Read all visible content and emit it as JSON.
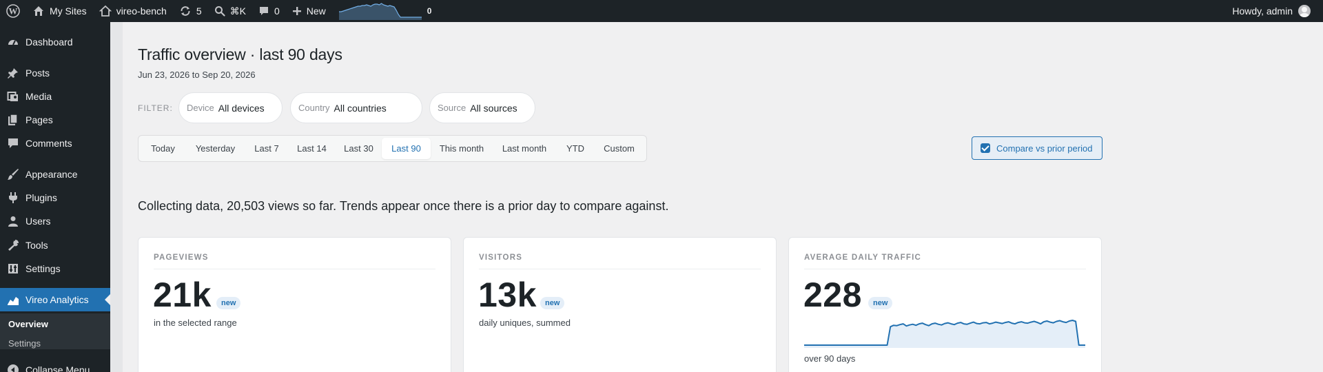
{
  "admin_bar": {
    "my_sites": "My Sites",
    "site_name": "vireo-bench",
    "updates_count": "5",
    "search_shortcut": "⌘K",
    "comments_count": "0",
    "new_label": "New",
    "spark_count": "0",
    "howdy": "Howdy, admin"
  },
  "sidebar": {
    "items": [
      {
        "label": "Dashboard",
        "icon": "dashboard-icon"
      },
      {
        "label": "Posts",
        "icon": "pin-icon"
      },
      {
        "label": "Media",
        "icon": "media-icon"
      },
      {
        "label": "Pages",
        "icon": "pages-icon"
      },
      {
        "label": "Comments",
        "icon": "comment-icon"
      },
      {
        "label": "Appearance",
        "icon": "brush-icon"
      },
      {
        "label": "Plugins",
        "icon": "plugin-icon"
      },
      {
        "label": "Users",
        "icon": "user-icon"
      },
      {
        "label": "Tools",
        "icon": "wrench-icon"
      },
      {
        "label": "Settings",
        "icon": "settings-icon"
      },
      {
        "label": "Vireo Analytics",
        "icon": "chart-icon"
      }
    ],
    "submenu": [
      {
        "label": "Overview"
      },
      {
        "label": "Settings"
      }
    ],
    "collapse": "Collapse Menu"
  },
  "page": {
    "title": "Traffic overview · last 90 days",
    "date_range": "Jun 23, 2026 to Sep 20, 2026",
    "filter_label": "FILTER:",
    "filters": [
      {
        "key": "Device",
        "value": "All devices"
      },
      {
        "key": "Country",
        "value": "All countries"
      },
      {
        "key": "Source",
        "value": "All sources"
      }
    ],
    "tabs": [
      "Today",
      "Yesterday",
      "Last 7",
      "Last 14",
      "Last 30",
      "Last 90",
      "This month",
      "Last month",
      "YTD",
      "Custom"
    ],
    "active_tab": "Last 90",
    "compare_label": "Compare vs prior period",
    "compare_checked": true,
    "collecting_message": "Collecting data, 20,503 views so far. Trends appear once there is a prior day to compare against."
  },
  "cards": [
    {
      "title": "PAGEVIEWS",
      "value": "21k",
      "badge": "new",
      "note": "in the selected range"
    },
    {
      "title": "VISITORS",
      "value": "13k",
      "badge": "new",
      "note": "daily uniques, summed"
    },
    {
      "title": "AVERAGE DAILY TRAFFIC",
      "value": "228",
      "badge": "new",
      "note": "over 90 days"
    }
  ],
  "colors": {
    "accent": "#2271b1",
    "admin_dark": "#1d2327",
    "spark_fill": "#e4eef8"
  },
  "sparkline": {
    "days": 90,
    "series": [
      0,
      0,
      0,
      0,
      0,
      0,
      0,
      0,
      0,
      0,
      0,
      0,
      0,
      0,
      0,
      0,
      0,
      0,
      0,
      0,
      0,
      0,
      0,
      0,
      0,
      0,
      0,
      260,
      280,
      275,
      290,
      300,
      270,
      285,
      295,
      280,
      300,
      310,
      290,
      275,
      300,
      310,
      295,
      285,
      305,
      315,
      300,
      290,
      310,
      320,
      300,
      295,
      310,
      325,
      305,
      300,
      315,
      320,
      300,
      310,
      325,
      315,
      305,
      320,
      330,
      310,
      300,
      320,
      330,
      315,
      310,
      325,
      335,
      320,
      300,
      330,
      340,
      325,
      315,
      335,
      345,
      330,
      320,
      340,
      350,
      335,
      0,
      0,
      0
    ]
  },
  "header_spark": {
    "series": [
      10,
      10,
      11,
      12,
      13,
      14,
      15,
      16,
      17,
      18,
      18,
      19,
      19,
      20,
      19,
      18,
      20,
      21,
      21,
      20,
      22,
      20,
      19,
      18,
      19,
      18,
      17,
      12,
      6,
      2,
      2,
      2,
      2,
      2,
      2,
      2,
      2,
      2,
      2,
      2
    ]
  }
}
